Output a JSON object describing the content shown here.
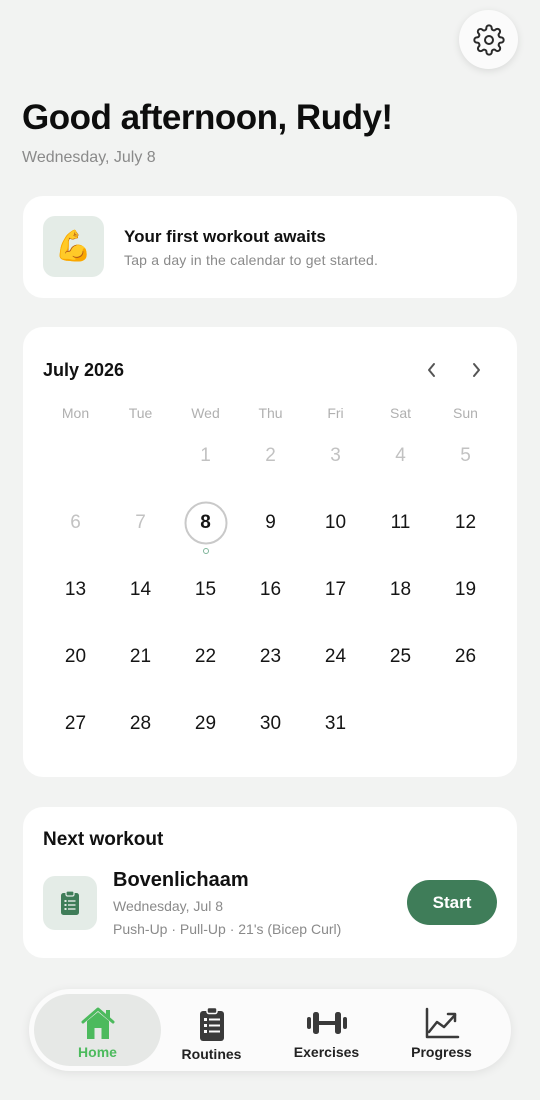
{
  "greeting": "Good afternoon, Rudy!",
  "date": "Wednesday, July 8",
  "promo": {
    "icon": "flexed-biceps-icon",
    "emoji": "💪",
    "title": "Your first workout awaits",
    "subtitle": "Tap a day in the calendar to get started."
  },
  "calendar": {
    "month_label": "July 2026",
    "weekdays": [
      "Mon",
      "Tue",
      "Wed",
      "Thu",
      "Fri",
      "Sat",
      "Sun"
    ],
    "leading_blanks": 2,
    "days": [
      {
        "n": "1",
        "muted": true
      },
      {
        "n": "2",
        "muted": true
      },
      {
        "n": "3",
        "muted": true
      },
      {
        "n": "4",
        "muted": true
      },
      {
        "n": "5",
        "muted": true
      },
      {
        "n": "6",
        "muted": true
      },
      {
        "n": "7",
        "muted": true
      },
      {
        "n": "8",
        "today": true,
        "has_workout": true
      },
      {
        "n": "9"
      },
      {
        "n": "10"
      },
      {
        "n": "11"
      },
      {
        "n": "12"
      },
      {
        "n": "13"
      },
      {
        "n": "14"
      },
      {
        "n": "15"
      },
      {
        "n": "16"
      },
      {
        "n": "17"
      },
      {
        "n": "18"
      },
      {
        "n": "19"
      },
      {
        "n": "20"
      },
      {
        "n": "21"
      },
      {
        "n": "22"
      },
      {
        "n": "23"
      },
      {
        "n": "24"
      },
      {
        "n": "25"
      },
      {
        "n": "26"
      },
      {
        "n": "27"
      },
      {
        "n": "28"
      },
      {
        "n": "29"
      },
      {
        "n": "30"
      },
      {
        "n": "31"
      }
    ]
  },
  "next_workout": {
    "heading": "Next workout",
    "name": "Bovenlichaam",
    "date": "Wednesday, Jul 8",
    "exercises": "Push-Up · Pull-Up · 21's (Bicep Curl)",
    "start_label": "Start"
  },
  "tabs": [
    {
      "label": "Home",
      "icon": "home-icon",
      "active": true
    },
    {
      "label": "Routines",
      "icon": "clipboard-list-icon"
    },
    {
      "label": "Exercises",
      "icon": "dumbbell-icon"
    },
    {
      "label": "Progress",
      "icon": "chart-line-icon"
    }
  ],
  "colors": {
    "accent_green": "#3f7d59",
    "active_tab_green": "#4cba5d",
    "icon_tile_bg": "#e4ece7",
    "workout_dot": "#7fb59a"
  }
}
